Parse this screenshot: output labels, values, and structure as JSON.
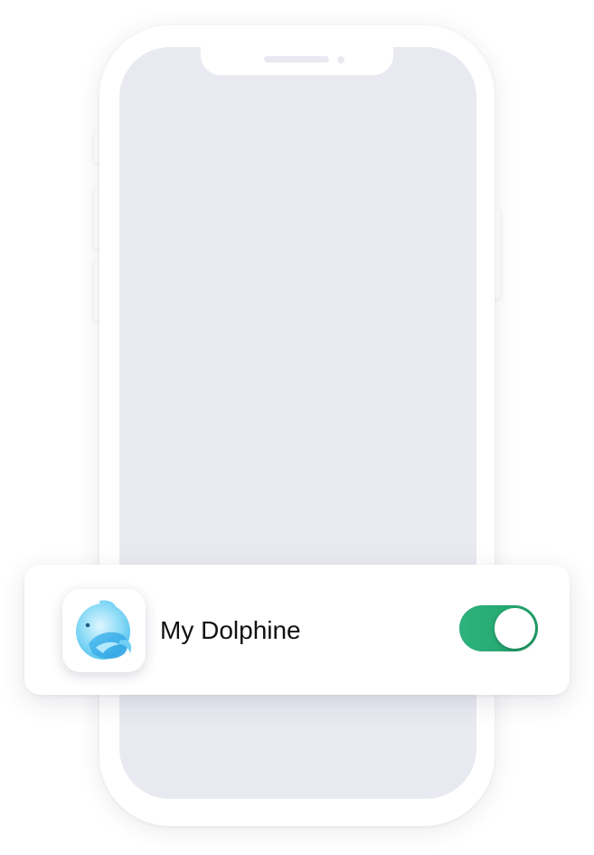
{
  "notification": {
    "app_name": "My Dolphine",
    "app_icon": "dolphin-icon",
    "toggle": {
      "state": "on",
      "color": "#22a86e"
    }
  },
  "device": {
    "type": "phone-mockup",
    "screen_color": "#e9eaf1"
  }
}
